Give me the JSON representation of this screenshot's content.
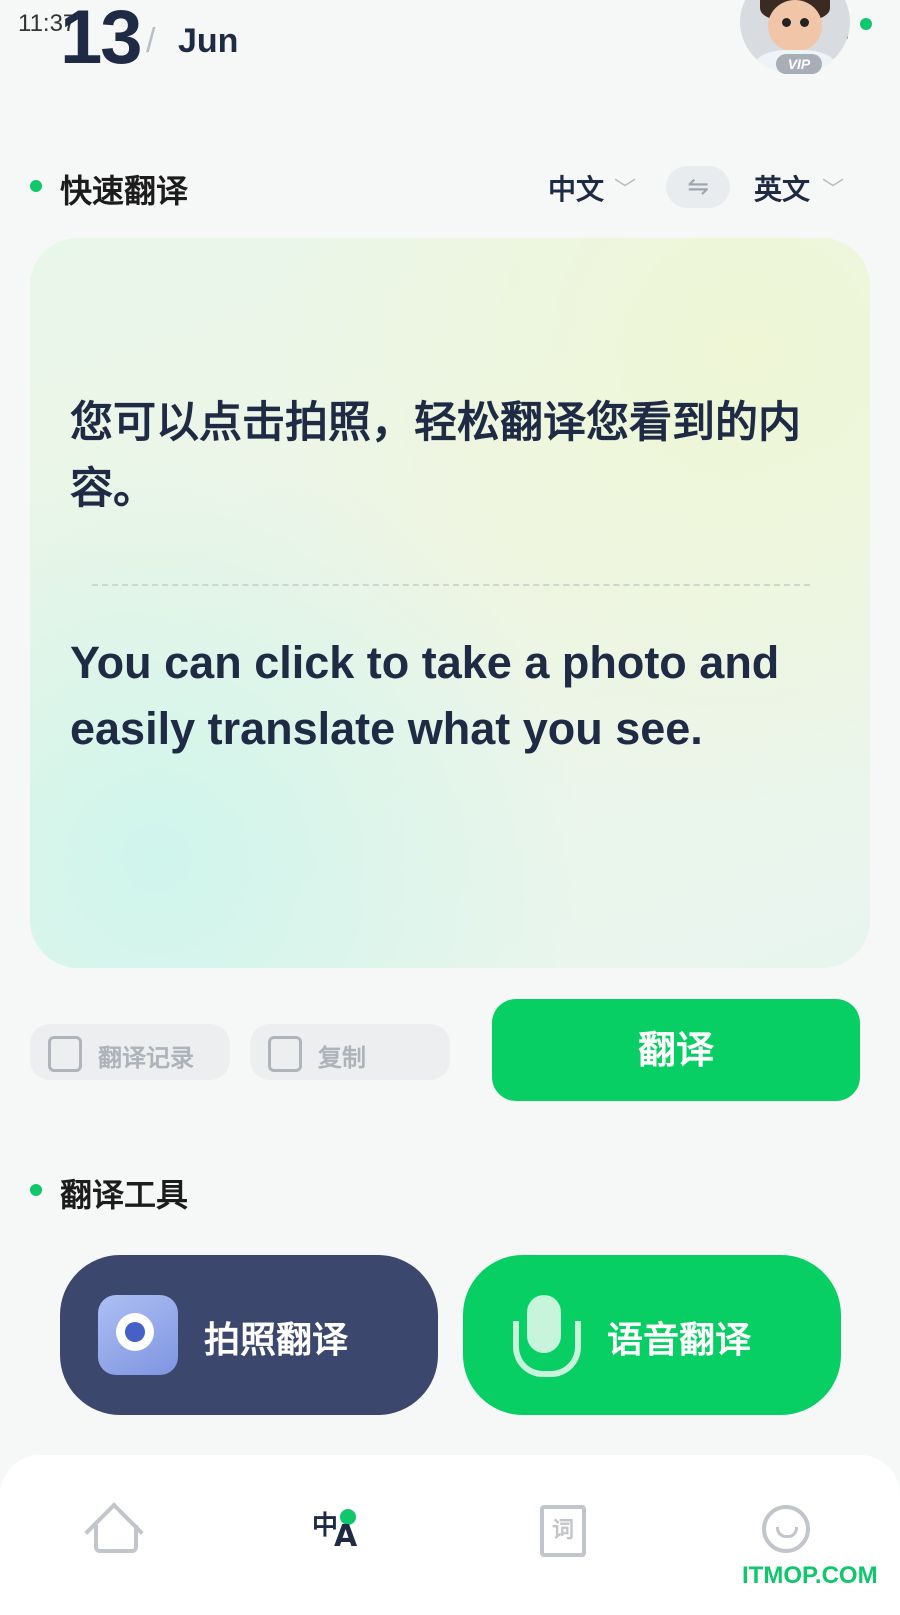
{
  "status_bar": {
    "time": "11:37"
  },
  "date": {
    "day": "13",
    "separator": "/",
    "month": "Jun"
  },
  "profile": {
    "badge": "VIP"
  },
  "quick_translate": {
    "title": "快速翻译",
    "source_lang": "中文",
    "target_lang": "英文",
    "source_text": "您可以点击拍照，轻松翻译您看到的内容。",
    "target_text": "You can click to take a photo and easily translate what you see.",
    "history_label": "翻译记录",
    "copy_label": "复制",
    "translate_label": "翻译"
  },
  "tools": {
    "title": "翻译工具",
    "photo_label": "拍照翻译",
    "voice_label": "语音翻译"
  },
  "bottom_nav": {
    "translate_glyph_zh": "中",
    "translate_glyph_en": "A",
    "dict_glyph": "词"
  },
  "watermark": "ITMOP.COM",
  "colors": {
    "accent": "#07cf63",
    "navy": "#3b476d",
    "text": "#1f2a44"
  }
}
